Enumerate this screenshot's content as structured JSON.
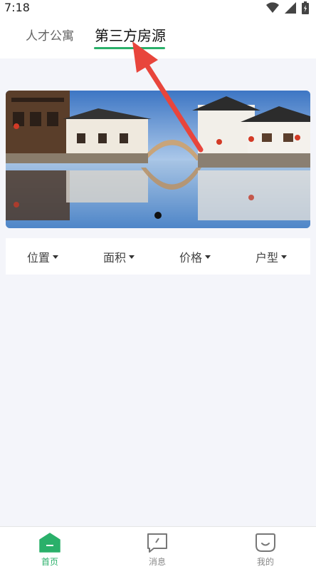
{
  "status_bar": {
    "time": "7:18"
  },
  "tabs": [
    {
      "label": "人才公寓",
      "active": false
    },
    {
      "label": "第三方房源",
      "active": true
    }
  ],
  "banner": {
    "active_index": 0,
    "total": 1
  },
  "filters": [
    {
      "label": "位置"
    },
    {
      "label": "面积"
    },
    {
      "label": "价格"
    },
    {
      "label": "户型"
    }
  ],
  "bottom_nav": [
    {
      "label": "首页",
      "icon": "home-icon",
      "active": true
    },
    {
      "label": "消息",
      "icon": "message-icon",
      "active": false
    },
    {
      "label": "我的",
      "icon": "profile-icon",
      "active": false
    }
  ],
  "colors": {
    "accent": "#2ab06a",
    "background": "#f4f5fa",
    "annotation_arrow": "#e8453c"
  }
}
